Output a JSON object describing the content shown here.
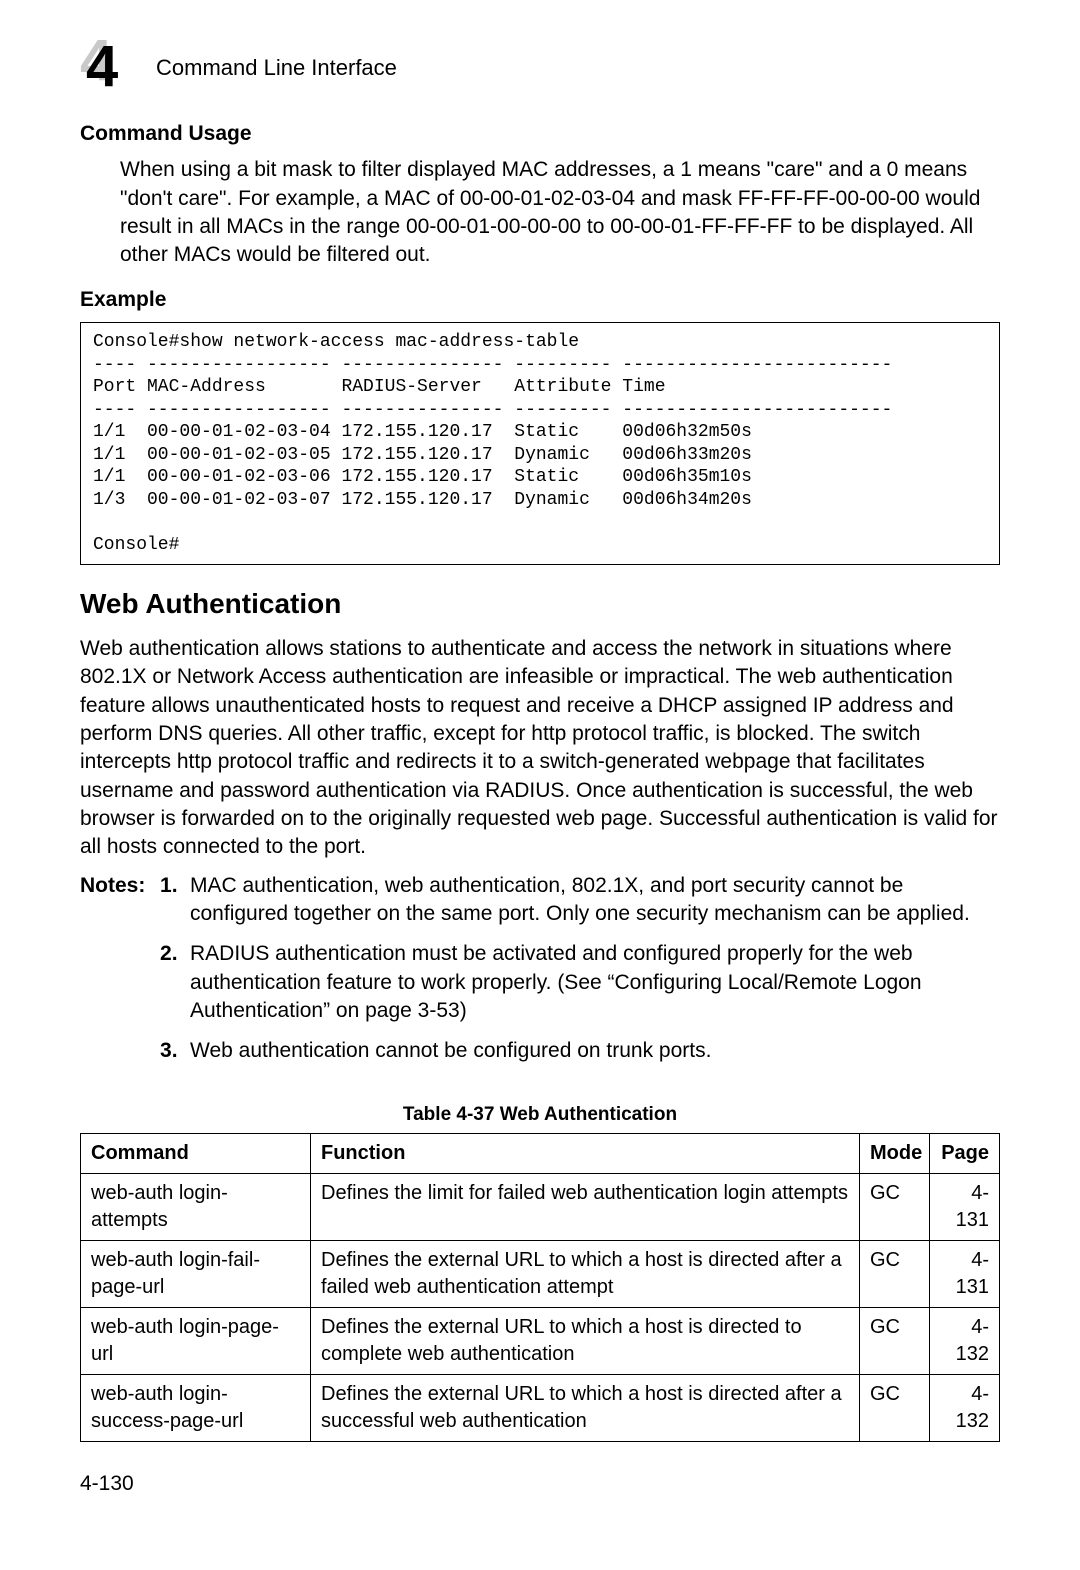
{
  "header": {
    "chapter_number": "4",
    "chapter_title": "Command Line Interface"
  },
  "sections": {
    "command_usage": {
      "heading": "Command Usage",
      "body": "When using a bit mask to filter displayed MAC addresses, a 1 means \"care\" and a 0 means \"don't care\". For example, a MAC of 00-00-01-02-03-04 and mask FF-FF-FF-00-00-00 would result in all MACs in the range 00-00-01-00-00-00 to 00-00-01-FF-FF-FF to be displayed. All other MACs would be filtered out."
    },
    "example": {
      "heading": "Example",
      "console": "Console#show network-access mac-address-table\n---- ----------------- --------------- --------- -------------------------\nPort MAC-Address       RADIUS-Server   Attribute Time\n---- ----------------- --------------- --------- -------------------------\n1/1  00-00-01-02-03-04 172.155.120.17  Static    00d06h32m50s\n1/1  00-00-01-02-03-05 172.155.120.17  Dynamic   00d06h33m20s\n1/1  00-00-01-02-03-06 172.155.120.17  Static    00d06h35m10s\n1/3  00-00-01-02-03-07 172.155.120.17  Dynamic   00d06h34m20s\n\nConsole#"
    },
    "web_auth": {
      "heading": "Web Authentication",
      "body": "Web authentication allows stations to authenticate and access the network in situations where 802.1X or Network Access authentication are infeasible or impractical. The web authentication feature allows unauthenticated hosts to request and receive a DHCP assigned IP address and perform DNS queries. All other traffic, except for http protocol traffic, is blocked. The switch intercepts http protocol traffic and redirects it to a switch-generated webpage that facilitates username and password authentication via RADIUS. Once authentication is successful, the web browser is forwarded on to the originally requested web page. Successful authentication is valid for all hosts connected to the port.",
      "notes_label": "Notes:",
      "notes": [
        "MAC authentication, web authentication, 802.1X, and port security cannot be configured together on the same port. Only one security mechanism can be applied.",
        "RADIUS authentication must be activated and configured properly for the web authentication feature to work properly. (See “Configuring Local/Remote Logon Authentication” on page 3-53)",
        "Web authentication cannot be configured on trunk ports."
      ]
    }
  },
  "table": {
    "caption": "Table 4-37  Web Authentication",
    "headers": {
      "command": "Command",
      "function": "Function",
      "mode": "Mode",
      "page": "Page"
    },
    "rows": [
      {
        "command": "web-auth login-attempts",
        "function": "Defines the limit for failed web authentication login attempts",
        "mode": "GC",
        "page": "4-131"
      },
      {
        "command": "web-auth login-fail-page-url",
        "function": "Defines the external URL to which a host is directed after a failed web authentication attempt",
        "mode": "GC",
        "page": "4-131"
      },
      {
        "command": "web-auth login-page-url",
        "function": "Defines the external URL to which a host is directed to complete web authentication",
        "mode": "GC",
        "page": "4-132"
      },
      {
        "command": "web-auth login-success-page-url",
        "function": "Defines the external URL to which a host is directed after a successful web authentication",
        "mode": "GC",
        "page": "4-132"
      }
    ]
  },
  "footer": {
    "page_number": "4-130"
  }
}
